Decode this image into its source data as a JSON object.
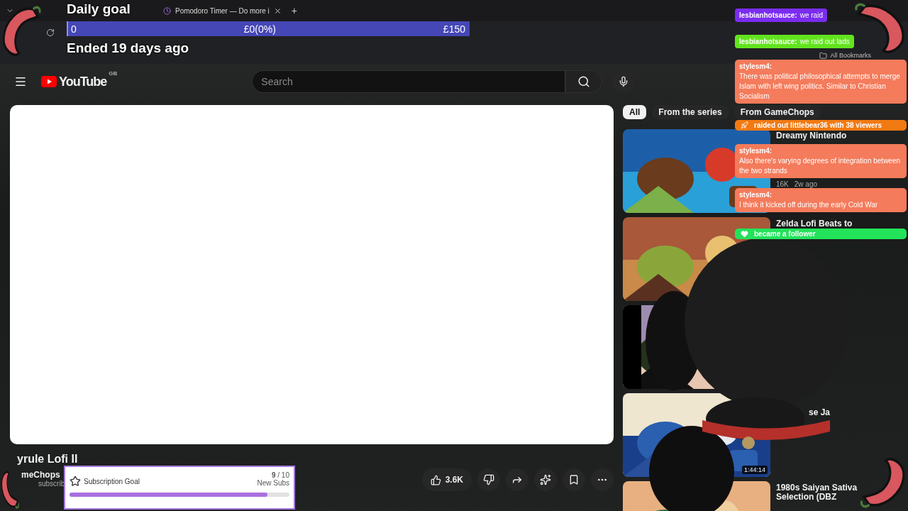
{
  "browser": {
    "tabs": [
      {
        "title": "Pomodoro Timer — Do more i",
        "selected": false
      }
    ],
    "new_tab": "+",
    "bookmarks": "All Bookmarks"
  },
  "daily_goal": {
    "title": "Daily goal",
    "start": "0",
    "current": "£0(0%)",
    "level": 0,
    "target": "£150",
    "status": "Ended 19 days ago"
  },
  "youtube": {
    "logo": "YouTube",
    "region": "GB",
    "search": {
      "placeholder": "Search"
    },
    "chips": [
      {
        "label": "All",
        "selected": true
      },
      {
        "label": "From the series",
        "selected": false
      },
      {
        "label": "From GameChops",
        "selected": false
      }
    ],
    "video": {
      "title": "yrule Lofi II",
      "channel": "meChops",
      "subscribers": "subscrib",
      "likes": "3.6K"
    },
    "related": [
      {
        "kind": "picture",
        "title": "Dreamy Nintendo",
        "meta": [
          "16K",
          "2w ago"
        ]
      },
      {
        "kind": "picture",
        "title": "Zelda Lofi Beats to"
      },
      {
        "kind": "picture"
      },
      {
        "kind": "picture",
        "title": "se Ja",
        "duration": "1:44:14"
      },
      {
        "kind": "picture",
        "title": "1980s Saiyan Sativa Selection (DBZ"
      }
    ]
  },
  "chat": [
    {
      "kind": "banner",
      "user": "lesbianhotsauce:",
      "text": "we raid",
      "color": "#7b2cf0"
    },
    {
      "kind": "banner",
      "user": "lesbianhotsauce:",
      "text": "we raid out lads",
      "color": "#62e41e"
    },
    {
      "kind": "message",
      "user": "stylesm4:",
      "text": "There was political philosophical attempts to merge Islam with left wing politics. Similar to Christian Socialism",
      "color": "#f47b5b"
    },
    {
      "kind": "raid",
      "text": "raided out littlebear36 with 38 viewers",
      "color": "#f27a12"
    },
    {
      "kind": "message",
      "user": "stylesm4:",
      "text": "Also there's varying degrees of integration between the two strands",
      "color": "#f47b5b"
    },
    {
      "kind": "message",
      "user": "stylesm4:",
      "text": "I think it kicked off during the early Cold War",
      "color": "#f47b5b"
    },
    {
      "kind": "follow",
      "text": "became a follower",
      "color": "#22e35a"
    }
  ],
  "subscription_goal": {
    "title": "Subscription Goal",
    "count": "9",
    "total": "/ 10",
    "unit": "New Subs",
    "level": 0.9
  }
}
